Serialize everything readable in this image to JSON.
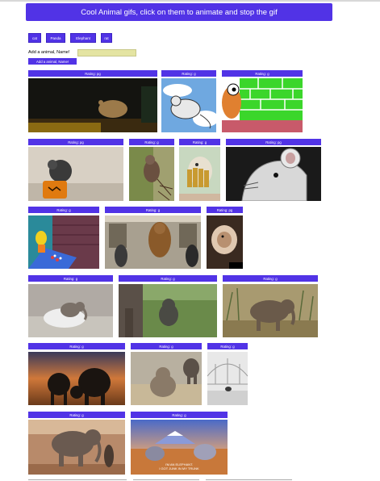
{
  "header": {
    "title": "Cool Animal gifs, click on them to animate and stop the gif"
  },
  "animal_buttons": [
    "cat",
    "Panda",
    "Elephant",
    "rat"
  ],
  "add_form": {
    "label": "Add a animal, Name!",
    "input_value": "",
    "submit_label": "Add a animal, Name!"
  },
  "gifs": [
    {
      "rating": "Rating: pg",
      "subject": "rat"
    },
    {
      "rating": "Rating: g",
      "subject": "rat"
    },
    {
      "rating": "Rating: g",
      "subject": "rat"
    },
    {
      "rating": "Rating: pg",
      "subject": "rat"
    },
    {
      "rating": "Rating: g",
      "subject": "rat"
    },
    {
      "rating": "Rating: g",
      "subject": "rat"
    },
    {
      "rating": "Rating: pg",
      "subject": "rat"
    },
    {
      "rating": "Rating: g",
      "subject": "rat"
    },
    {
      "rating": "Rating: g",
      "subject": "rat"
    },
    {
      "rating": "Rating: pg",
      "subject": "rat"
    },
    {
      "rating": "Rating: g",
      "subject": "elephant"
    },
    {
      "rating": "Rating: g",
      "subject": "elephant"
    },
    {
      "rating": "Rating: g",
      "subject": "elephant"
    },
    {
      "rating": "Rating: g",
      "subject": "elephant"
    },
    {
      "rating": "Rating: g",
      "subject": "elephant"
    },
    {
      "rating": "Rating: g",
      "subject": "elephant"
    },
    {
      "rating": "Rating: g",
      "subject": "elephant"
    },
    {
      "rating": "Rating: g",
      "subject": "elephant"
    }
  ],
  "caption_last": {
    "line1": "I'M AN ELEPHANT.",
    "line2": "I GOT JUNK IN MY TRUNK"
  },
  "colors": {
    "accent": "#5133e6",
    "input_bg": "#e4e4a2"
  }
}
